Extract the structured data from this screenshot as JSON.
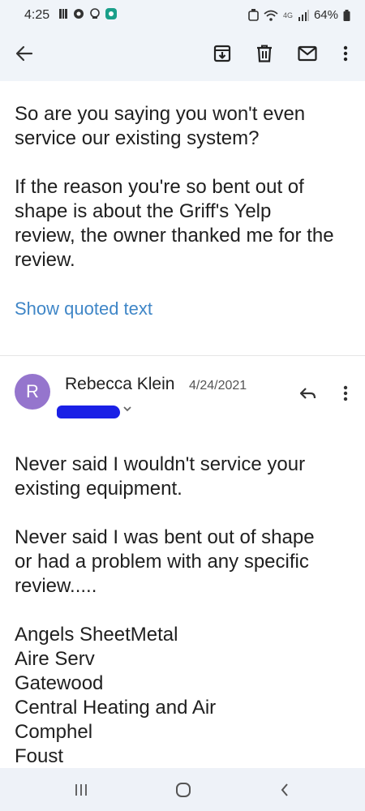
{
  "status_bar": {
    "time": "4:25",
    "network": "4G",
    "battery": "64%"
  },
  "toolbar": {
    "back_icon": "arrow-left-icon",
    "archive_icon": "archive-icon",
    "delete_icon": "trash-icon",
    "mark_unread_icon": "envelope-icon",
    "more_icon": "more-vert-icon"
  },
  "quoted_message": {
    "paragraphs": [
      "So are you saying you won't even\nservice our existing system?",
      "If the reason you're so bent out of\nshape is about the Griff's Yelp\nreview, the owner thanked me for the\nreview."
    ],
    "show_quoted_label": "Show quoted text"
  },
  "message": {
    "avatar_letter": "R",
    "avatar_color": "#9575cd",
    "sender": "Rebecca Klein",
    "date": "4/24/2021",
    "paragraphs": [
      "Never said I wouldn't service your\nexisting equipment.",
      "Never said I was bent out of shape\nor had a problem with any specific\nreview.....",
      "Angels SheetMetal\nAire Serv\nGatewood\nCentral Heating and Air\nComphel\nFoust"
    ]
  },
  "colors": {
    "link": "#3f86c7",
    "top_background": "#f0f4f9"
  }
}
